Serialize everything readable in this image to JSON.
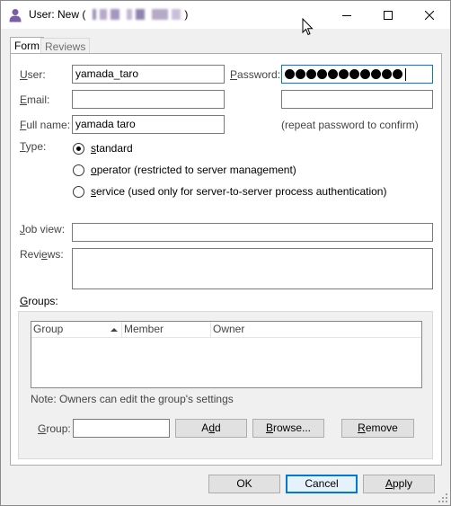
{
  "window": {
    "title_prefix": "User: New (",
    "title_suffix": ")",
    "minimize_glyph": "—",
    "maximize_glyph": "☐",
    "close_glyph": "✕"
  },
  "tabs": [
    {
      "label": "Form",
      "active": true
    },
    {
      "label": "Reviews",
      "active": false
    }
  ],
  "form": {
    "user_label_key": "U",
    "user_label_rest": "ser:",
    "user_value": "yamada_taro",
    "password_label_key": "P",
    "password_label_rest": "assword:",
    "password_length": 11,
    "email_label_key": "E",
    "email_label_rest": "mail:",
    "email_value": "",
    "fullname_label_key": "F",
    "fullname_label_rest": "ull name:",
    "fullname_value": "yamada taro",
    "confirm_value": "",
    "confirm_hint": "(repeat password to confirm)",
    "type_label_key": "T",
    "type_label_rest": "ype:",
    "type_options": [
      {
        "key": "s",
        "rest": "tandard",
        "checked": true
      },
      {
        "key": "o",
        "rest": "perator (restricted to server management)",
        "checked": false
      },
      {
        "key": "s",
        "rest": "ervice (used only for server-to-server process authentication)",
        "checked": false
      }
    ],
    "jobview_label_key": "J",
    "jobview_label_rest": "ob view:",
    "jobview_value": "",
    "reviews_label_pre": "Revi",
    "reviews_label_key": "e",
    "reviews_label_rest": "ws:",
    "reviews_value": ""
  },
  "groups": {
    "label_key": "G",
    "label_rest": "roups:",
    "columns": [
      "Group",
      "Member",
      "Owner"
    ],
    "rows": [],
    "note": "Note: Owners can edit the group's settings",
    "group_field_label_key": "G",
    "group_field_label_rest": "roup:",
    "group_field_value": "",
    "add_pre": "A",
    "add_key": "d",
    "add_rest": "d",
    "browse_key": "B",
    "browse_rest": "rowse...",
    "remove_key": "R",
    "remove_rest": "emove"
  },
  "footer": {
    "ok_label": "OK",
    "cancel_label": "Cancel",
    "apply_key": "A",
    "apply_rest": "pply"
  },
  "colors": {
    "accent": "#0078d7",
    "window_bg": "#f0f0f0"
  }
}
